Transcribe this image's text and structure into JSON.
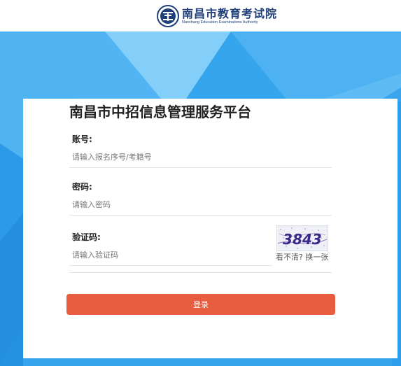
{
  "header": {
    "logo_cn": "南昌市教育考试院",
    "logo_en": "Nanchang Education Examinations Authority"
  },
  "login": {
    "title": "南昌市中招信息管理服务平台",
    "account_label": "账号:",
    "account_placeholder": "请输入报名序号/考籍号",
    "password_label": "密码:",
    "password_placeholder": "请输入密码",
    "captcha_label": "验证码:",
    "captcha_placeholder": "请输入验证码",
    "captcha_code": "3843",
    "captcha_refresh": "看不清? 换一张",
    "submit_label": "登录"
  },
  "colors": {
    "background": "#35a5ee",
    "button": "#e85c3f",
    "brand": "#1f3f7a"
  }
}
